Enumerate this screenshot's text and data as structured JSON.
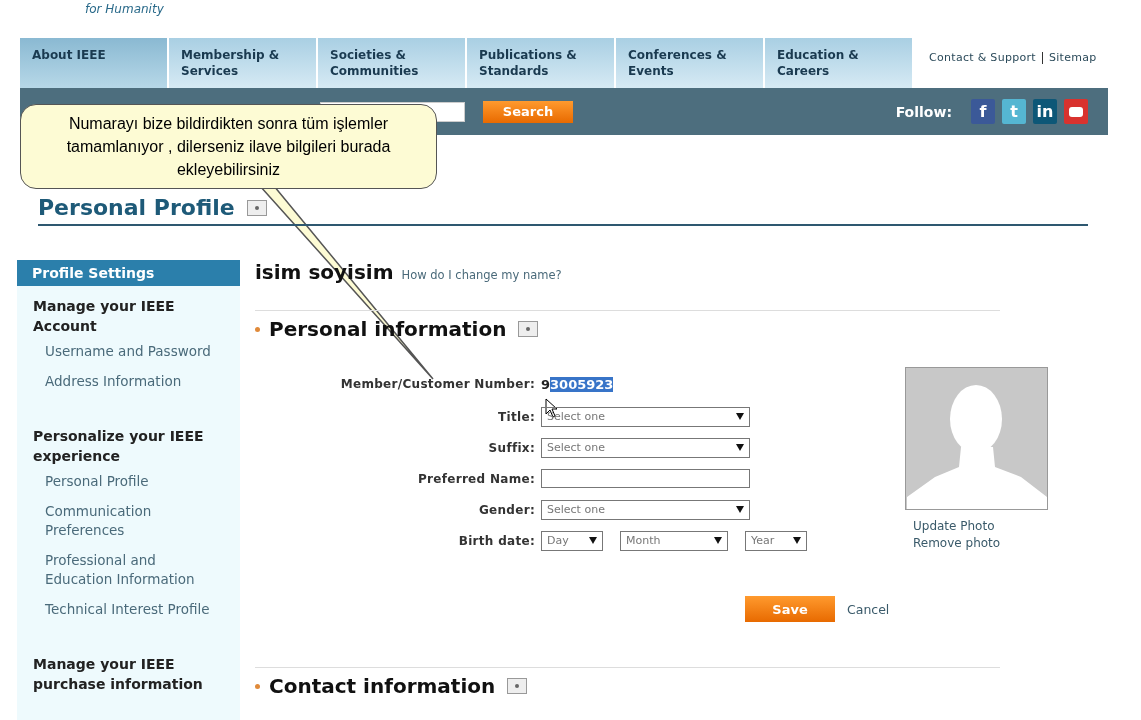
{
  "logo": {
    "tagline": "for Humanity"
  },
  "nav_tabs": [
    {
      "label": "About IEEE",
      "selected": true
    },
    {
      "label": "Membership & Services",
      "selected": false
    },
    {
      "label": "Societies & Communities",
      "selected": false
    },
    {
      "label": "Publications & Standards",
      "selected": false
    },
    {
      "label": "Conferences & Events",
      "selected": false
    },
    {
      "label": "Education & Careers",
      "selected": false
    }
  ],
  "top_links": [
    "Contact & Support",
    "Sitemap"
  ],
  "search": {
    "button": "Search"
  },
  "follow": {
    "label": "Follow:",
    "icons": [
      {
        "label": "f",
        "color": "#3b5998"
      },
      {
        "label": "t",
        "color": "#55b6d2"
      },
      {
        "label": "in",
        "color": "#0d5777"
      },
      {
        "color": "#d9322e"
      }
    ]
  },
  "callout": {
    "text": "Numarayı bize bildirdikten sonra tüm işlemler tamamlanıyor , dilerseniz ilave bilgileri burada ekleyebilirsiniz"
  },
  "page_title": "Personal Profile",
  "sidebar": {
    "header": "Profile Settings",
    "groups": [
      {
        "title": "Manage your IEEE Account",
        "links": [
          "Username and Password",
          "Address Information"
        ]
      },
      {
        "title": "Personalize your IEEE experience",
        "links": [
          "Personal Profile",
          "Communication Preferences",
          "Professional and Education Information",
          "Technical Interest Profile"
        ]
      },
      {
        "title": "Manage your IEEE purchase information"
      }
    ]
  },
  "name": {
    "value": "isim soyisim",
    "link": "How do I change my name?"
  },
  "personal_info": {
    "heading": "Personal information",
    "member_number": {
      "label": "Member/Customer Number:",
      "prefix": "9",
      "selected_part": "3005923"
    },
    "fields": [
      {
        "kind": "select",
        "label": "Title:",
        "placeholder": "Select one"
      },
      {
        "kind": "select",
        "label": "Suffix:",
        "placeholder": "Select one"
      },
      {
        "kind": "text",
        "label": "Preferred Name:"
      },
      {
        "kind": "select",
        "label": "Gender:",
        "placeholder": "Select one"
      },
      {
        "kind": "date",
        "label": "Birth date:",
        "parts": [
          "Day",
          "Month",
          "Year"
        ]
      }
    ],
    "photo_links": [
      "Update Photo",
      "Remove photo"
    ],
    "save": "Save",
    "cancel": "Cancel"
  },
  "contact_info": {
    "heading": "Contact information"
  }
}
